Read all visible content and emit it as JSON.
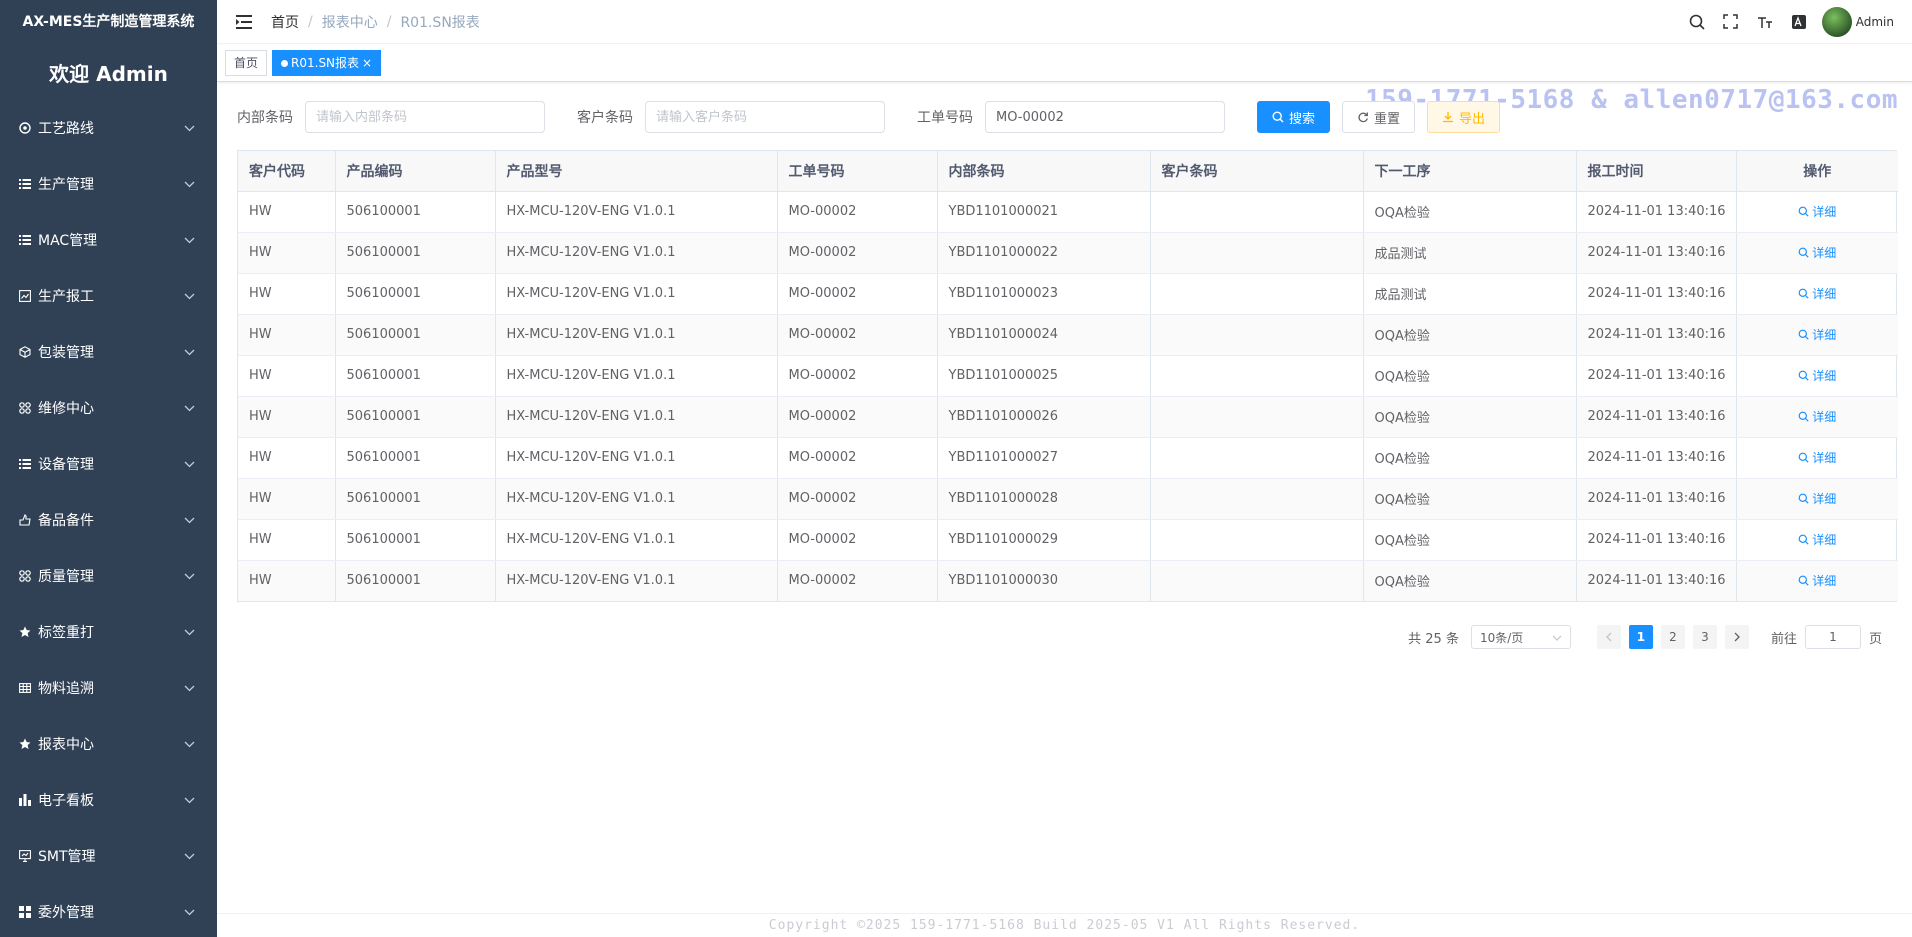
{
  "app": {
    "title": "AX-MES生产制造管理系统",
    "welcome": "欢迎 Admin"
  },
  "sidebar": {
    "items": [
      {
        "label": "工艺路线",
        "icon": "route-icon"
      },
      {
        "label": "生产管理",
        "icon": "list-icon"
      },
      {
        "label": "MAC管理",
        "icon": "list-icon"
      },
      {
        "label": "生产报工",
        "icon": "chart-icon"
      },
      {
        "label": "包装管理",
        "icon": "box-icon"
      },
      {
        "label": "维修中心",
        "icon": "grid-icon"
      },
      {
        "label": "设备管理",
        "icon": "list-icon"
      },
      {
        "label": "备品备件",
        "icon": "spare-parts-icon"
      },
      {
        "label": "质量管理",
        "icon": "grid-icon"
      },
      {
        "label": "标签重打",
        "icon": "star-icon"
      },
      {
        "label": "物料追溯",
        "icon": "table-icon"
      },
      {
        "label": "报表中心",
        "icon": "star-icon"
      },
      {
        "label": "电子看板",
        "icon": "bar-chart-icon"
      },
      {
        "label": "SMT管理",
        "icon": "monitor-icon"
      },
      {
        "label": "委外管理",
        "icon": "apps-icon"
      }
    ]
  },
  "breadcrumb": {
    "home": "首页",
    "section": "报表中心",
    "current": "R01.SN报表"
  },
  "header": {
    "user": "Admin"
  },
  "tags": {
    "home": "首页",
    "active": "R01.SN报表"
  },
  "watermark": "159-1771-5168 & allen0717@163.com",
  "search": {
    "internal_label": "内部条码",
    "internal_placeholder": "请输入内部条码",
    "customer_label": "客户条码",
    "customer_placeholder": "请输入客户条码",
    "order_label": "工单号码",
    "order_value": "MO-00002",
    "search_btn": "搜索",
    "reset_btn": "重置",
    "export_btn": "导出"
  },
  "table": {
    "columns": [
      "客户代码",
      "产品编码",
      "产品型号",
      "工单号码",
      "内部条码",
      "客户条码",
      "下一工序",
      "报工时间",
      "操作"
    ],
    "action_label": "详细",
    "rows": [
      [
        "HW",
        "506100001",
        "HX-MCU-120V-ENG V1.0.1",
        "MO-00002",
        "YBD1101000021",
        "",
        "OQA检验",
        "2024-11-01 13:40:16"
      ],
      [
        "HW",
        "506100001",
        "HX-MCU-120V-ENG V1.0.1",
        "MO-00002",
        "YBD1101000022",
        "",
        "成品测试",
        "2024-11-01 13:40:16"
      ],
      [
        "HW",
        "506100001",
        "HX-MCU-120V-ENG V1.0.1",
        "MO-00002",
        "YBD1101000023",
        "",
        "成品测试",
        "2024-11-01 13:40:16"
      ],
      [
        "HW",
        "506100001",
        "HX-MCU-120V-ENG V1.0.1",
        "MO-00002",
        "YBD1101000024",
        "",
        "OQA检验",
        "2024-11-01 13:40:16"
      ],
      [
        "HW",
        "506100001",
        "HX-MCU-120V-ENG V1.0.1",
        "MO-00002",
        "YBD1101000025",
        "",
        "OQA检验",
        "2024-11-01 13:40:16"
      ],
      [
        "HW",
        "506100001",
        "HX-MCU-120V-ENG V1.0.1",
        "MO-00002",
        "YBD1101000026",
        "",
        "OQA检验",
        "2024-11-01 13:40:16"
      ],
      [
        "HW",
        "506100001",
        "HX-MCU-120V-ENG V1.0.1",
        "MO-00002",
        "YBD1101000027",
        "",
        "OQA检验",
        "2024-11-01 13:40:16"
      ],
      [
        "HW",
        "506100001",
        "HX-MCU-120V-ENG V1.0.1",
        "MO-00002",
        "YBD1101000028",
        "",
        "OQA检验",
        "2024-11-01 13:40:16"
      ],
      [
        "HW",
        "506100001",
        "HX-MCU-120V-ENG V1.0.1",
        "MO-00002",
        "YBD1101000029",
        "",
        "OQA检验",
        "2024-11-01 13:40:16"
      ],
      [
        "HW",
        "506100001",
        "HX-MCU-120V-ENG V1.0.1",
        "MO-00002",
        "YBD1101000030",
        "",
        "OQA检验",
        "2024-11-01 13:40:16"
      ]
    ]
  },
  "pagination": {
    "total": "共 25 条",
    "page_size": "10条/页",
    "pages": [
      "1",
      "2",
      "3"
    ],
    "current": "1",
    "goto_label": "前往",
    "goto_value": "1",
    "page_unit": "页"
  },
  "footer": "Copyright ©2025 159-1771-5168 Build 2025-05 V1 All Rights Reserved.",
  "colors": {
    "sidebar_bg": "#304156",
    "primary": "#1890ff",
    "warning": "#ffba00"
  }
}
